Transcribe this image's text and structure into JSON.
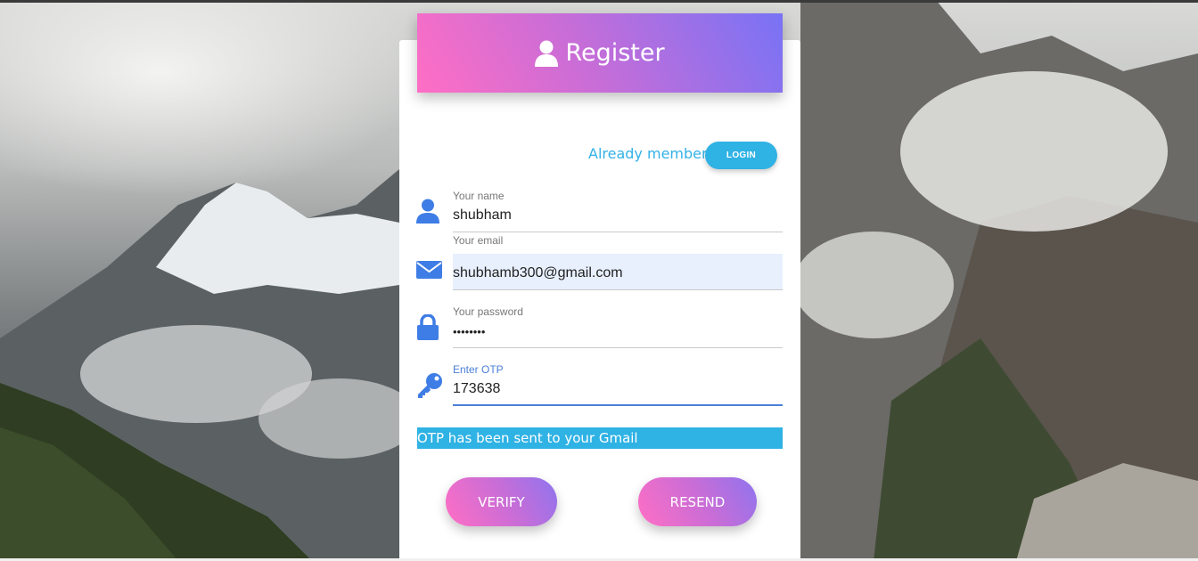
{
  "header": {
    "title": "Register",
    "icon": "user-icon"
  },
  "login_prompt": {
    "text": "Already member?",
    "button_label": "LOGIN"
  },
  "fields": {
    "name": {
      "label": "Your name",
      "value": "shubham",
      "icon": "user-icon"
    },
    "email": {
      "label": "Your email",
      "value": "shubhamb300@gmail.com",
      "icon": "envelope-icon"
    },
    "password": {
      "label": "Your password",
      "value": "••••••••",
      "icon": "lock-icon"
    },
    "otp": {
      "label": "Enter OTP",
      "value": "173638",
      "icon": "key-icon"
    }
  },
  "notice": "OTP has been sent to your Gmail",
  "actions": {
    "verify_label": "VERIFY",
    "resend_label": "RESEND"
  },
  "colors": {
    "accent_blue": "#2fb2e4",
    "icon_blue": "#3f7de6",
    "gradient_start": "#ff6ec4",
    "gradient_end": "#7873f5"
  }
}
